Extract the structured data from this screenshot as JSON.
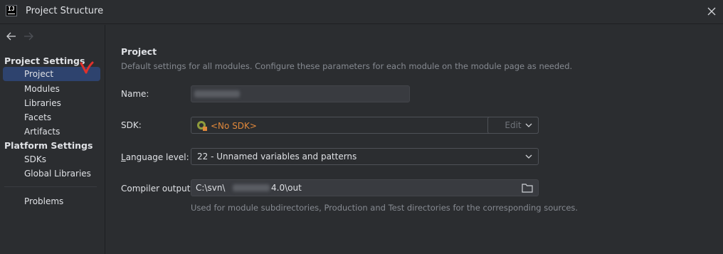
{
  "window": {
    "title": "Project Structure",
    "app_icon_text": "IJ"
  },
  "sidebar": {
    "project_settings_header": "Project Settings",
    "project_settings_items": [
      {
        "label": "Project",
        "selected": true
      },
      {
        "label": "Modules"
      },
      {
        "label": "Libraries"
      },
      {
        "label": "Facets"
      },
      {
        "label": "Artifacts"
      }
    ],
    "platform_settings_header": "Platform Settings",
    "platform_settings_items": [
      {
        "label": "SDKs"
      },
      {
        "label": "Global Libraries"
      }
    ],
    "problems_label": "Problems"
  },
  "main": {
    "title": "Project",
    "description": "Default settings for all modules. Configure these parameters for each module on the module page as needed.",
    "name_label": "Name:",
    "sdk_label": "SDK:",
    "sdk_value": "<No SDK>",
    "edit_button": "Edit",
    "language_level_label_mnemonic": "L",
    "language_level_label_rest": "anguage level:",
    "language_level_value": "22 - Unnamed variables and patterns",
    "compiler_output_label": "Compiler output:",
    "compiler_output_prefix": "C:\\svn\\",
    "compiler_output_suffix": "4.0\\out",
    "compiler_output_help": "Used for module subdirectories, Production and Test directories for the corresponding sources."
  },
  "colors": {
    "background": "#2b2d30",
    "selection": "#2e436e",
    "no_sdk_text": "#e0883b",
    "annotation_mark": "#e0312b"
  },
  "icons": {
    "back": "arrow-left-icon",
    "forward": "arrow-right-icon",
    "close": "close-icon",
    "sdk": "java-sdk-icon",
    "folder": "folder-icon",
    "dropdown": "chevron-down-icon"
  }
}
